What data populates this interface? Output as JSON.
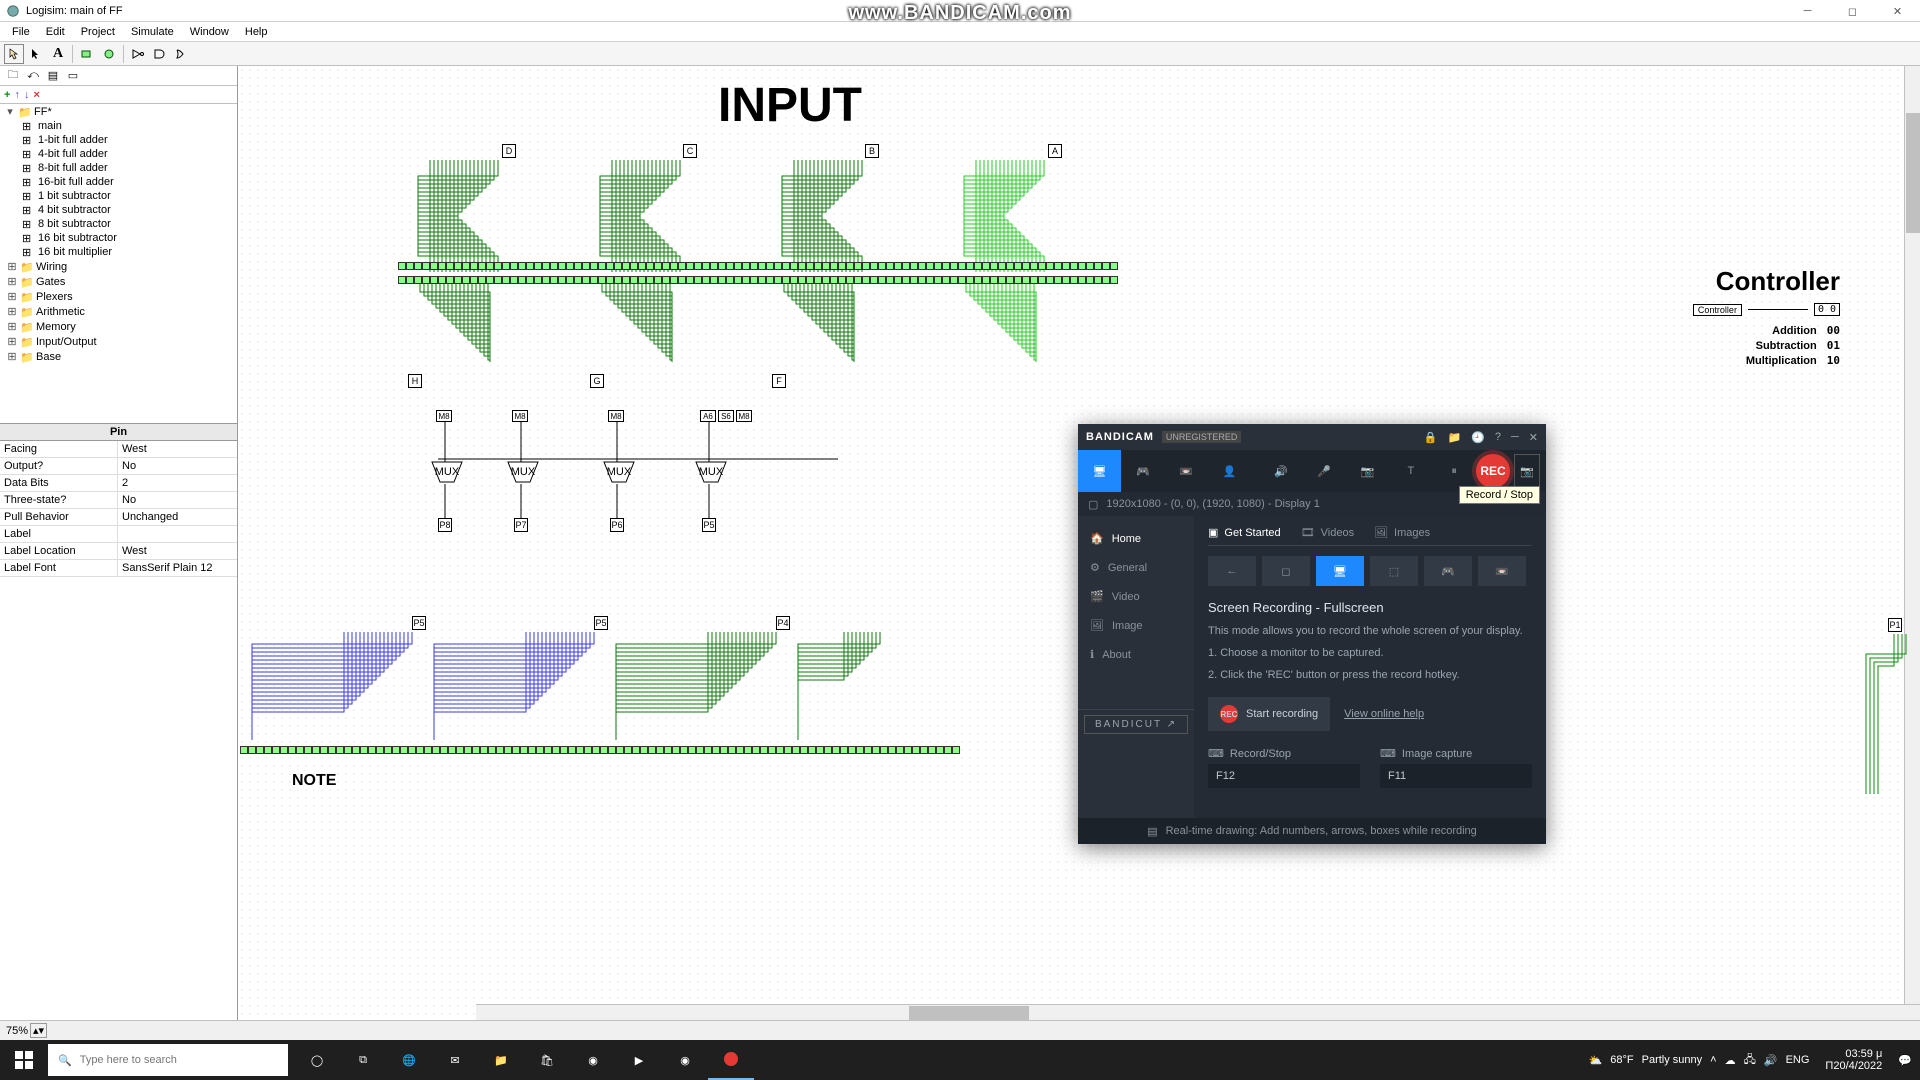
{
  "window": {
    "title": "Logisim: main of FF"
  },
  "watermark": "www.BANDICAM.com",
  "menus": [
    "File",
    "Edit",
    "Project",
    "Simulate",
    "Window",
    "Help"
  ],
  "tree": {
    "root": "FF*",
    "circuits": [
      "main",
      "1-bit full adder",
      "4-bit full adder",
      "8-bit full adder",
      "16-bit full adder",
      "1 bit subtractor",
      "4 bit subtractor",
      "8 bit subtractor",
      "16 bit subtractor",
      "16 bit multiplier"
    ],
    "libs": [
      "Wiring",
      "Gates",
      "Plexers",
      "Arithmetic",
      "Memory",
      "Input/Output",
      "Base"
    ]
  },
  "prop": {
    "title": "Pin",
    "rows": [
      {
        "k": "Facing",
        "v": "West"
      },
      {
        "k": "Output?",
        "v": "No"
      },
      {
        "k": "Data Bits",
        "v": "2"
      },
      {
        "k": "Three-state?",
        "v": "No"
      },
      {
        "k": "Pull Behavior",
        "v": "Unchanged"
      },
      {
        "k": "Label",
        "v": ""
      },
      {
        "k": "Label Location",
        "v": "West"
      },
      {
        "k": "Label Font",
        "v": "SansSerif Plain 12"
      }
    ]
  },
  "canvas": {
    "title": "INPUT",
    "input_pins": [
      "D",
      "C",
      "B",
      "A"
    ],
    "output_pins": [
      "H",
      "G",
      "F"
    ],
    "mux_labels": [
      "M8",
      "M8",
      "M8",
      "A6",
      "S6",
      "M8"
    ],
    "mux_out": [
      "P8",
      "P7",
      "P6",
      "P5"
    ],
    "lower_pins": [
      "P5",
      "P5",
      "P4",
      "P1"
    ],
    "note": "NOTE",
    "controller": {
      "title": "Controller",
      "pin": "Controller",
      "pin_val": "0 0",
      "rows": [
        {
          "label": "Addition",
          "code": "00"
        },
        {
          "label": "Subtraction",
          "code": "01"
        },
        {
          "label": "Multiplication",
          "code": "10"
        }
      ]
    }
  },
  "status": {
    "zoom": "75%"
  },
  "bandicam": {
    "brand": "BANDICAM",
    "unreg": "UNREGISTERED",
    "rec_label": "REC",
    "rec_tooltip": "Record / Stop",
    "resolution": "1920x1080 - (0, 0), (1920, 1080) - Display 1",
    "side": [
      "Home",
      "General",
      "Video",
      "Image",
      "About"
    ],
    "tabs": [
      "Get Started",
      "Videos",
      "Images"
    ],
    "heading": "Screen Recording - Fullscreen",
    "desc": "This mode allows you to record the whole screen of your display.",
    "step1": "1. Choose a monitor to be captured.",
    "step2": "2. Click the 'REC' button or press the record hotkey.",
    "start": "Start recording",
    "help": "View online help",
    "hk1_label": "Record/Stop",
    "hk1_val": "F12",
    "hk2_label": "Image capture",
    "hk2_val": "F11",
    "bandicut": "BANDICUT ↗",
    "footer": "Real-time drawing: Add numbers, arrows, boxes while recording"
  },
  "taskbar": {
    "search_placeholder": "Type here to search",
    "weather_temp": "68°F",
    "weather_desc": "Partly sunny",
    "lang": "ENG",
    "time": "03:59 μ",
    "date": "Π20/4/2022"
  }
}
